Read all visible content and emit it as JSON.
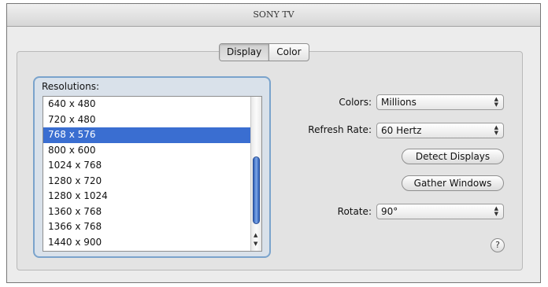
{
  "window": {
    "title": "SONY TV"
  },
  "tabs": [
    {
      "label": "Display",
      "selected": true
    },
    {
      "label": "Color",
      "selected": false
    }
  ],
  "resolutions": {
    "label": "Resolutions:",
    "items": [
      "640 x 480",
      "720 x 480",
      "768 x 576",
      "800 x 600",
      "1024 x 768",
      "1280 x 720",
      "1280 x 1024",
      "1360 x 768",
      "1366 x 768",
      "1440 x 900"
    ],
    "selected": "768 x 576"
  },
  "colors": {
    "label": "Colors:",
    "value": "Millions"
  },
  "refresh": {
    "label": "Refresh Rate:",
    "value": "60 Hertz"
  },
  "buttons": {
    "detect": "Detect Displays",
    "gather": "Gather Windows"
  },
  "rotate": {
    "label": "Rotate:",
    "value": "90°"
  },
  "help": {
    "symbol": "?"
  },
  "accent_colors": {
    "selection": "#3a6ed1",
    "group_border": "#7aa3cc"
  }
}
